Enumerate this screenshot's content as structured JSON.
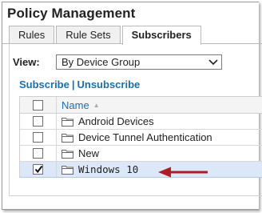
{
  "header": {
    "title": "Policy Management"
  },
  "tabs": [
    {
      "label": "Rules",
      "active": false
    },
    {
      "label": "Rule Sets",
      "active": false
    },
    {
      "label": "Subscribers",
      "active": true
    }
  ],
  "view": {
    "label": "View:",
    "selected": "By Device Group"
  },
  "actions": {
    "subscribe": "Subscribe",
    "separator": "|",
    "unsubscribe": "Unsubscribe"
  },
  "table": {
    "column_header": "Name",
    "sort": "ascending",
    "rows": [
      {
        "label": "Android Devices",
        "checked": false
      },
      {
        "label": "Device Tunnel Authentication",
        "checked": false
      },
      {
        "label": "New",
        "checked": false
      },
      {
        "label": "Windows 10",
        "checked": true,
        "selected": true
      }
    ]
  },
  "annotation": {
    "arrow_color": "#b01c25",
    "points_to": "Windows 10"
  },
  "colors": {
    "link": "#1f6ea8",
    "selected_row": "#dce7f7"
  }
}
